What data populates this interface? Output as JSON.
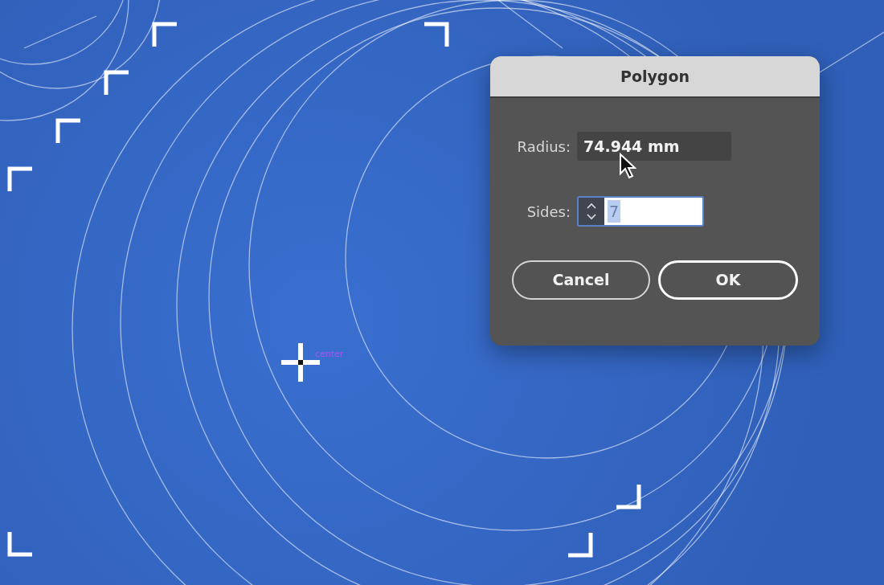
{
  "canvas": {
    "center_label": "center"
  },
  "dialog": {
    "title": "Polygon",
    "fields": [
      {
        "kind": "text",
        "label": "Radius:",
        "value": "74.944 mm",
        "selected": false
      },
      {
        "kind": "spinner",
        "label": "Sides:",
        "value": "7",
        "selected": true
      }
    ],
    "buttons": [
      {
        "label": "Cancel",
        "default": false
      },
      {
        "label": "OK",
        "default": true
      }
    ]
  }
}
